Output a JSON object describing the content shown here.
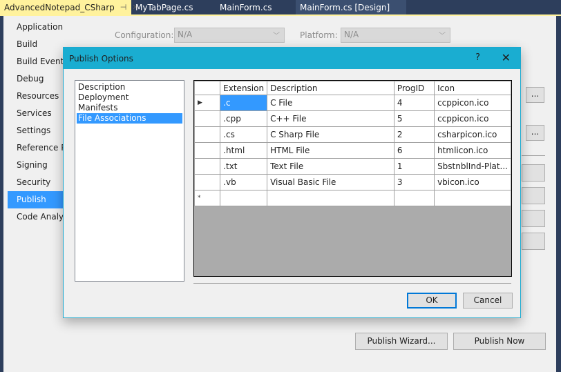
{
  "tabs": [
    {
      "label": "AdvancedNotepad_CSharp",
      "active": true,
      "pin_icon": "pin-icon",
      "close_icon": "close-icon"
    },
    {
      "label": "MyTabPage.cs"
    },
    {
      "label": "MainForm.cs"
    },
    {
      "label": "MainForm.cs [Design]"
    }
  ],
  "sidebar": {
    "items": [
      {
        "label": "Application"
      },
      {
        "label": "Build"
      },
      {
        "label": "Build Events"
      },
      {
        "label": "Debug"
      },
      {
        "label": "Resources"
      },
      {
        "label": "Services"
      },
      {
        "label": "Settings"
      },
      {
        "label": "Reference Paths"
      },
      {
        "label": "Signing"
      },
      {
        "label": "Security"
      },
      {
        "label": "Publish",
        "selected": true
      },
      {
        "label": "Code Analysis"
      }
    ]
  },
  "config": {
    "configuration_label": "Configuration:",
    "configuration_value": "N/A",
    "platform_label": "Platform:",
    "platform_value": "N/A"
  },
  "background_buttons": {
    "browse1": "...",
    "browse2": "...",
    "publish_wizard": "Publish Wizard...",
    "publish_now": "Publish Now"
  },
  "dialog": {
    "title": "Publish Options",
    "help": "?",
    "close": "✕",
    "categories": [
      {
        "label": "Description"
      },
      {
        "label": "Deployment"
      },
      {
        "label": "Manifests"
      },
      {
        "label": "File Associations",
        "selected": true
      }
    ],
    "grid": {
      "columns": [
        "Extension",
        "Description",
        "ProgID",
        "Icon"
      ],
      "rows": [
        {
          "indicator": "▶",
          "extension": ".c",
          "description": "C File",
          "progid": "4",
          "icon": "ccppicon.ico"
        },
        {
          "indicator": "",
          "extension": ".cpp",
          "description": "C++ File",
          "progid": "5",
          "icon": "ccppicon.ico"
        },
        {
          "indicator": "",
          "extension": ".cs",
          "description": "C Sharp File",
          "progid": "2",
          "icon": "csharpicon.ico"
        },
        {
          "indicator": "",
          "extension": ".html",
          "description": "HTML File",
          "progid": "6",
          "icon": "htmlicon.ico"
        },
        {
          "indicator": "",
          "extension": ".txt",
          "description": "Text File",
          "progid": "1",
          "icon": "SbstnblInd-Plat..."
        },
        {
          "indicator": "",
          "extension": ".vb",
          "description": "Visual Basic File",
          "progid": "3",
          "icon": "vbicon.ico"
        }
      ],
      "new_row_indicator": "*"
    },
    "ok_label": "OK",
    "cancel_label": "Cancel"
  }
}
